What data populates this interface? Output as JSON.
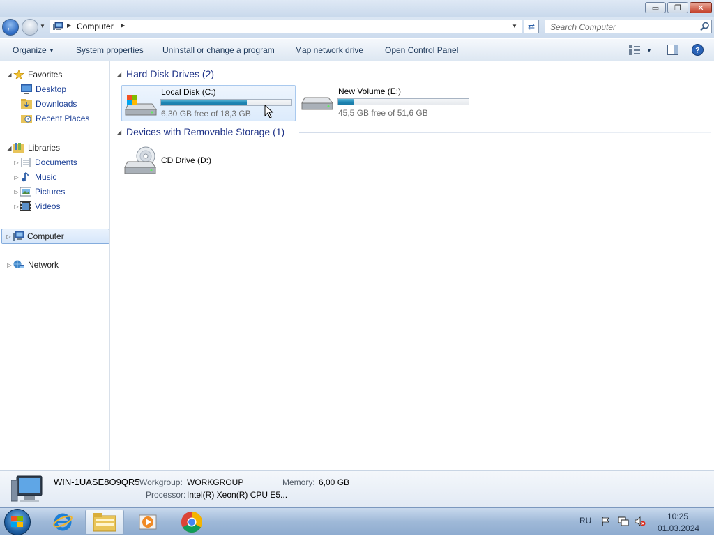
{
  "window": {
    "buttons": {
      "minimize": "▭",
      "maximize": "❐",
      "close": "✕"
    }
  },
  "address_bar": {
    "location": "Computer",
    "search_placeholder": "Search Computer"
  },
  "toolbar": {
    "organize": "Organize",
    "system_properties": "System properties",
    "uninstall": "Uninstall or change a program",
    "map_drive": "Map network drive",
    "control_panel": "Open Control Panel"
  },
  "nav": {
    "favorites": {
      "label": "Favorites",
      "items": [
        {
          "label": "Desktop"
        },
        {
          "label": "Downloads"
        },
        {
          "label": "Recent Places"
        }
      ]
    },
    "libraries": {
      "label": "Libraries",
      "items": [
        {
          "label": "Documents"
        },
        {
          "label": "Music"
        },
        {
          "label": "Pictures"
        },
        {
          "label": "Videos"
        }
      ]
    },
    "computer": "Computer",
    "network": "Network"
  },
  "content": {
    "hdd_group": "Hard Disk Drives (2)",
    "removable_group": "Devices with Removable Storage (1)",
    "drives": [
      {
        "name": "Local Disk (C:)",
        "free": "6,30 GB free of 18,3 GB",
        "used_fraction": 0.656
      },
      {
        "name": "New Volume (E:)",
        "free": "45,5 GB free of 51,6 GB",
        "used_fraction": 0.118
      }
    ],
    "cd": {
      "name": "CD Drive (D:)"
    }
  },
  "details": {
    "computer_name": "WIN-1UASE8O9QR5",
    "workgroup_label": "Workgroup:",
    "workgroup": "WORKGROUP",
    "memory_label": "Memory:",
    "memory": "6,00 GB",
    "processor_label": "Processor:",
    "processor": "Intel(R) Xeon(R) CPU E5..."
  },
  "taskbar": {
    "lang": "RU",
    "time": "10:25",
    "date": "01.03.2024"
  },
  "colors": {
    "accent": "#1e86b4",
    "nav_link": "#1b3f96",
    "group_header": "#1e3287"
  }
}
